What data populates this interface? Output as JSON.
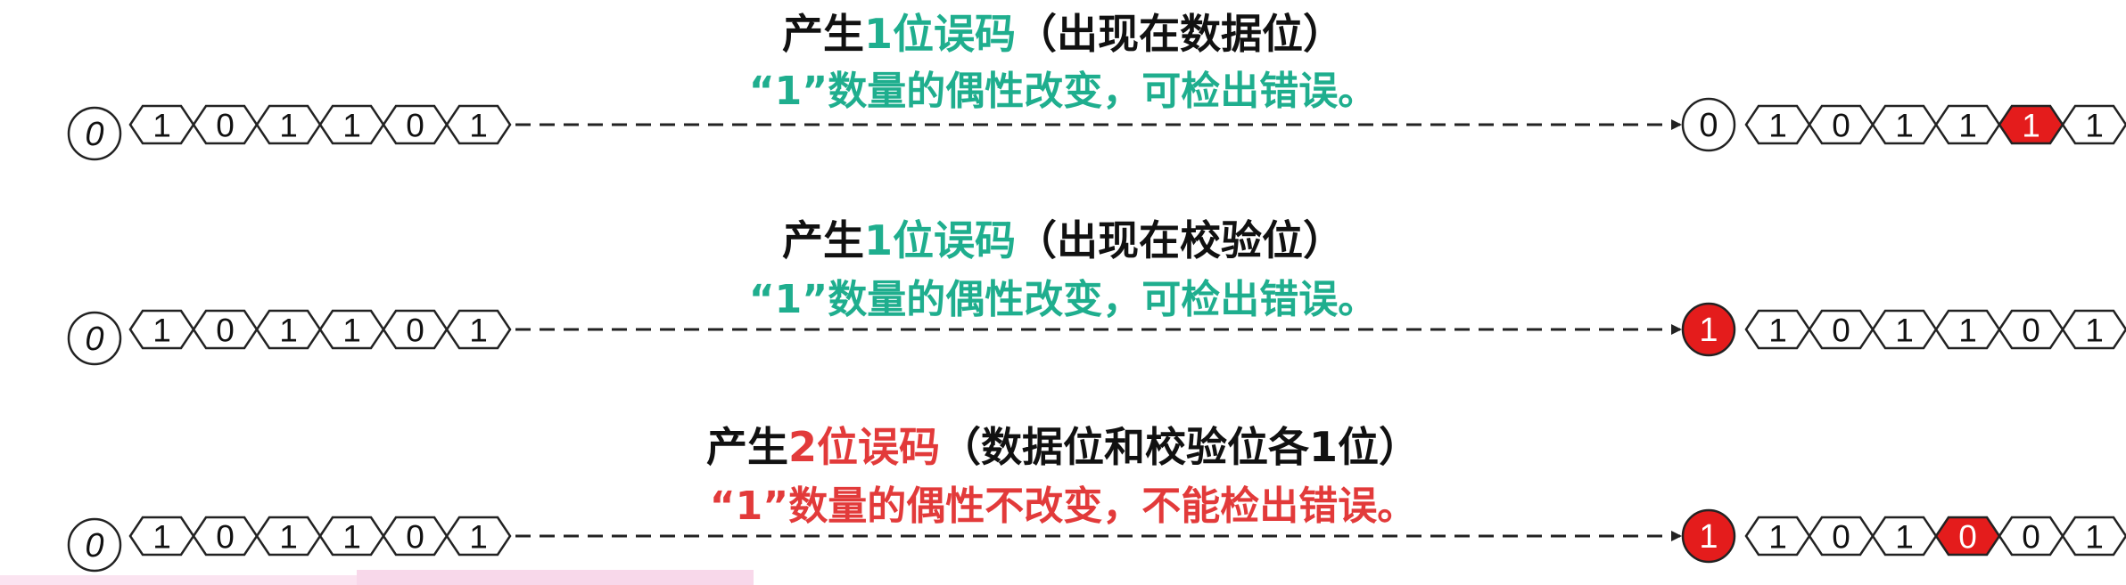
{
  "colors": {
    "teal": "#1fae8e",
    "red": "#e23a3a",
    "error_fill": "#e41c1c",
    "text": "#111111",
    "stroke": "#222222"
  },
  "rows": [
    {
      "title_prefix": "产生",
      "title_highlight": "1位误码",
      "title_suffix": "（出现在数据位）",
      "subtitle": "“1”数量的偶性改变，可检出错误。",
      "highlight_color": "teal",
      "left_parity": "0",
      "left_bits": [
        "1",
        "0",
        "1",
        "1",
        "0",
        "1"
      ],
      "right_parity": "0",
      "right_parity_error": false,
      "right_bits": [
        "1",
        "0",
        "1",
        "1",
        "1",
        "1"
      ],
      "right_errors": [
        false,
        false,
        false,
        false,
        true,
        false
      ]
    },
    {
      "title_prefix": "产生",
      "title_highlight": "1位误码",
      "title_suffix": "（出现在校验位）",
      "subtitle": "“1”数量的偶性改变，可检出错误。",
      "highlight_color": "teal",
      "left_parity": "0",
      "left_bits": [
        "1",
        "0",
        "1",
        "1",
        "0",
        "1"
      ],
      "right_parity": "1",
      "right_parity_error": true,
      "right_bits": [
        "1",
        "0",
        "1",
        "1",
        "0",
        "1"
      ],
      "right_errors": [
        false,
        false,
        false,
        false,
        false,
        false
      ]
    },
    {
      "title_prefix": "产生",
      "title_highlight": "2位误码",
      "title_suffix": "（数据位和校验位各1位）",
      "subtitle": "“1”数量的偶性不改变，不能检出错误。",
      "highlight_color": "red",
      "left_parity": "0",
      "left_bits": [
        "1",
        "0",
        "1",
        "1",
        "0",
        "1"
      ],
      "right_parity": "1",
      "right_parity_error": true,
      "right_bits": [
        "1",
        "0",
        "1",
        "0",
        "0",
        "1"
      ],
      "right_errors": [
        false,
        false,
        false,
        true,
        false,
        false
      ]
    }
  ]
}
